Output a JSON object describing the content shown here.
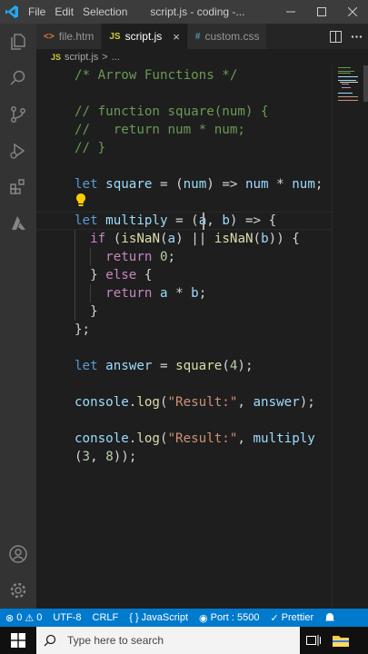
{
  "titlebar": {
    "menu": [
      "File",
      "Edit",
      "Selection"
    ],
    "title": "script.js - coding -...",
    "controls": [
      "minimize-icon",
      "restore-icon",
      "close-icon"
    ]
  },
  "tabs": [
    {
      "icon": "<>",
      "icon_color": "#e37933",
      "label": "file.htm",
      "active": false
    },
    {
      "icon": "JS",
      "icon_color": "#cbcb41",
      "label": "script.js",
      "active": true,
      "close": "×"
    },
    {
      "icon": "#",
      "icon_color": "#519aba",
      "label": "custom.css",
      "active": false
    }
  ],
  "breadcrumb": {
    "icon": "JS",
    "file": "script.js",
    "sep": ">",
    "more": "..."
  },
  "code": [
    "/* Arrow Functions */",
    "",
    "// function square(num) {",
    "//   return num * num;",
    "// }",
    "",
    "let square = (num) => num * num;",
    "",
    "let multiply = (a, b) => {",
    "  if (isNaN(a) || isNaN(b)) {",
    "    return 0;",
    "  } else {",
    "    return a * b;",
    "  }",
    "};",
    "",
    "let answer = square(4);",
    "",
    "console.log(\"Result:\", answer);",
    "",
    "console.log(\"Result:\", multiply",
    "(3, 8));"
  ],
  "statusbar": {
    "errors": "0",
    "warnings": "0",
    "encoding": "UTF-8",
    "eol": "CRLF",
    "language": "JavaScript",
    "port": "Port : 5500",
    "prettier": "Prettier"
  },
  "taskbar": {
    "search_placeholder": "Type here to search"
  },
  "colors": {
    "statusbar": "#007acc",
    "keyword": "#569cd6",
    "comment": "#6a9955",
    "function": "#dcdcaa",
    "string": "#ce9178",
    "number": "#b5cea8",
    "variable": "#9cdcfe"
  }
}
